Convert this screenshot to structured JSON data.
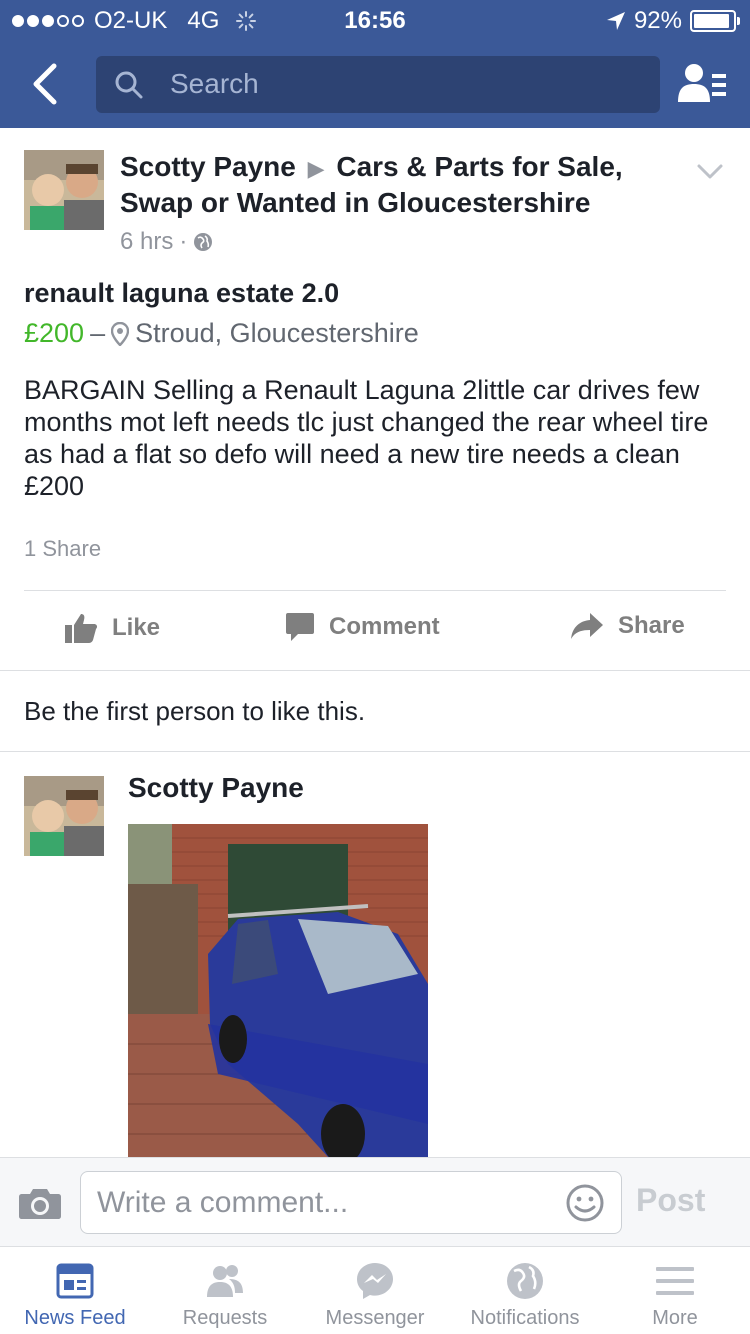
{
  "status_bar": {
    "carrier": "O2-UK",
    "network": "4G",
    "time": "16:56",
    "battery_percent": "92%",
    "battery_level": 0.92
  },
  "nav": {
    "search_placeholder": "Search"
  },
  "post": {
    "author": "Scotty Payne",
    "group": "Cars & Parts for Sale, Swap or Wanted in Gloucestershire",
    "time": "6 hrs",
    "listing_title": "renault laguna estate 2.0",
    "price": "£200",
    "price_separator": "–",
    "location": "Stroud, Gloucestershire",
    "body": "BARGAIN Selling a Renault Laguna 2little car drives few months mot left needs tlc just changed the rear wheel tire as had a flat so defo will need a new tire needs a clean  £200",
    "shares": "1 Share"
  },
  "actions": {
    "like": "Like",
    "comment": "Comment",
    "share": "Share"
  },
  "likes_message": "Be the first person to like this.",
  "comment": {
    "author": "Scotty Payne"
  },
  "comment_bar": {
    "placeholder": "Write a comment...",
    "post_label": "Post"
  },
  "tabs": [
    {
      "label": "News Feed",
      "icon": "news-feed-icon",
      "active": true
    },
    {
      "label": "Requests",
      "icon": "friend-requests-icon",
      "active": false
    },
    {
      "label": "Messenger",
      "icon": "messenger-icon",
      "active": false
    },
    {
      "label": "Notifications",
      "icon": "globe-icon",
      "active": false
    },
    {
      "label": "More",
      "icon": "menu-icon",
      "active": false
    }
  ],
  "colors": {
    "brand": "#3b5998",
    "price": "#42b72a",
    "active_tab": "#4267b2"
  }
}
